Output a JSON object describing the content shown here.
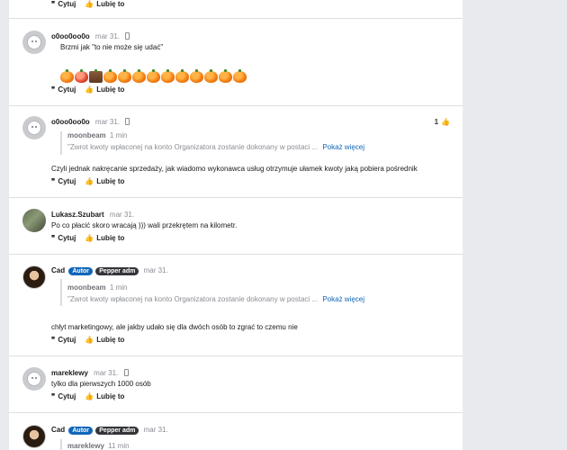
{
  "actions": {
    "quote": "Cytuj",
    "like": "Lubię to"
  },
  "show_more": "Pokaż więcej",
  "comments": [
    {
      "author": "o0oo0oo0o",
      "date": "mar 31.",
      "text": "Brzmi jak \"to nie może się udać\"",
      "emoji_count": 13
    },
    {
      "author": "o0oo0oo0o",
      "date": "mar 31.",
      "likes": "1",
      "quote": {
        "author": "moonbeam",
        "time": "1 min",
        "text": "\"Zwrot kwoty wpłaconej na konto Organizatora zostanie dokonany w postaci ..."
      },
      "text": "Czyli jednak nakręcanie sprzedaży, jak wiadomo wykonawca usług otrzymuje ułamek kwoty jaką pobiera pośrednik"
    },
    {
      "author": "Lukasz.Szubart",
      "date": "mar 31.",
      "text": "Po co płacić skoro wracają ))) wali przekrętem na kilometr."
    },
    {
      "author": "Cad",
      "badges": [
        "Autor",
        "Pepper adm"
      ],
      "date": "mar 31.",
      "quote": {
        "author": "moonbeam",
        "time": "1 min",
        "text": "\"Zwrot kwoty wpłaconej na konto Organizatora zostanie dokonany w postaci ..."
      },
      "text": "chłyt marketingowy, ale jakby udało się dla dwóch osób to zgrać to czemu nie"
    },
    {
      "author": "mareklewy",
      "date": "mar 31.",
      "text": "tylko dla pierwszych 1000 osób"
    },
    {
      "author": "Cad",
      "badges": [
        "Autor",
        "Pepper adm"
      ],
      "date": "mar 31.",
      "quote": {
        "author": "mareklewy",
        "time": "11 min"
      }
    }
  ]
}
